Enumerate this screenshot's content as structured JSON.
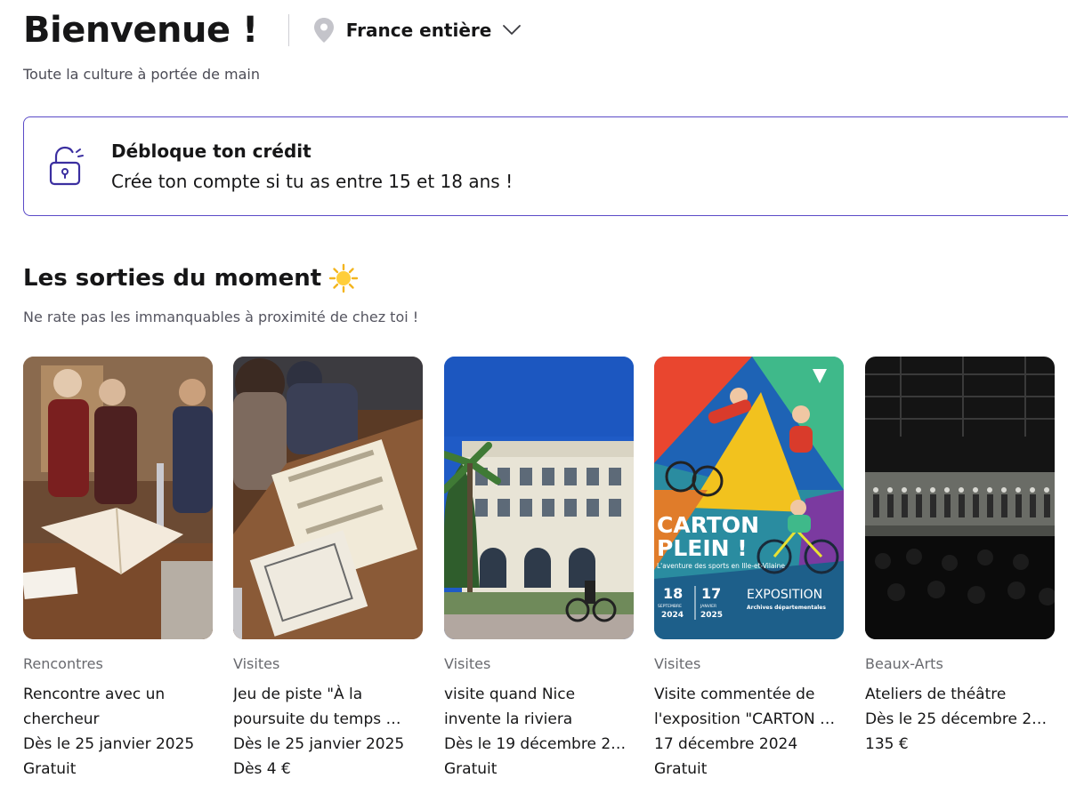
{
  "header": {
    "title": "Bienvenue !",
    "location": "France entière",
    "subtitle": "Toute la culture à portée de main"
  },
  "banner": {
    "title": "Débloque ton crédit",
    "text": "Crée ton compte si tu as entre 15 et 18 ans !"
  },
  "section": {
    "title": "Les sorties du moment",
    "subtitle": "Ne rate pas les immanquables à proximité de chez toi !"
  },
  "cards": [
    {
      "category": "Rencontres",
      "title": "Rencontre avec un chercheur",
      "date": "Dès le 25 janvier 2025",
      "price": "Gratuit"
    },
    {
      "category": "Visites",
      "title": "Jeu de piste \"À la poursuite du temps …",
      "date": "Dès le 25 janvier 2025",
      "price": "Dès 4 €"
    },
    {
      "category": "Visites",
      "title": "visite quand Nice invente la riviera",
      "date": "Dès le 19 décembre 2…",
      "price": "Gratuit"
    },
    {
      "category": "Visites",
      "title": "Visite commentée de l'exposition \"CARTON …",
      "date": "17 décembre 2024",
      "price": "Gratuit"
    },
    {
      "category": "Beaux-Arts",
      "title": "Ateliers de théâtre",
      "date": "Dès le 25 décembre 2…",
      "price": "135 €"
    }
  ],
  "poster": {
    "line1": "CARTON",
    "line2": "PLEIN !",
    "tagline": "L'aventure des sports en Ille-et-Vilaine",
    "day1": "18",
    "month1": "SEPTEMBRE",
    "year1": "2024",
    "day2": "17",
    "month2": "JANVIER",
    "year2": "2025",
    "exposition": "EXPOSITION",
    "archives": "Archives départementales"
  },
  "colors": {
    "accent": "#5a4ac7",
    "text": "#161617",
    "muted": "#696a6f"
  }
}
